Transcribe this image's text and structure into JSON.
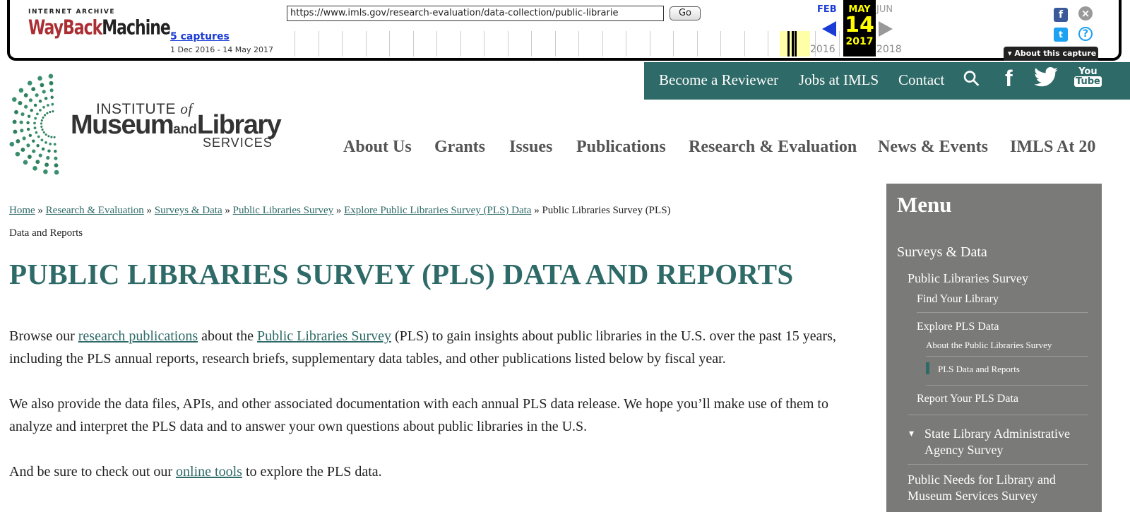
{
  "wayback": {
    "logo_top": "INTERNET ARCHIVE",
    "logo_main_1": "WayBack",
    "logo_main_2": "Machine",
    "url": "https://www.imls.gov/research-evaluation/data-collection/public-librarie",
    "go_label": "Go",
    "captures": "5 captures",
    "range": "1 Dec 2016 - 14 May 2017",
    "prev_month": "FEB",
    "cur_month": "MAY",
    "cur_day": "14",
    "cur_year": "2017",
    "next_month": "JUN",
    "prev_year": "2016",
    "next_year": "2018",
    "about": "About this capture",
    "facebook_glyph": "f",
    "twitter_glyph": "t",
    "close_glyph": "×",
    "help_glyph": "?"
  },
  "utility": {
    "reviewer": "Become a Reviewer",
    "jobs": "Jobs at IMLS",
    "contact": "Contact",
    "search_glyph": "⚲",
    "facebook_glyph": "f",
    "twitter_glyph": "🐦",
    "youtube_top": "You",
    "youtube_bottom": "Tube"
  },
  "logo": {
    "institute": "INSTITUTE",
    "of": "of",
    "museum": "Museum",
    "and": "and",
    "library": "Library",
    "services": "SERVICES"
  },
  "nav": [
    "About Us",
    "Grants",
    "Issues",
    "Publications",
    "Research & Evaluation",
    "News & Events",
    "IMLS At 20"
  ],
  "breadcrumb": {
    "home": "Home",
    "research": "Research & Evaluation",
    "surveys": "Surveys & Data",
    "pls": "Public Libraries Survey",
    "explore": "Explore Public Libraries Survey (PLS) Data",
    "sep": " » ",
    "current": "Public Libraries Survey (PLS) Data and Reports"
  },
  "title": "PUBLIC LIBRARIES SURVEY (PLS) DATA AND REPORTS",
  "p1": {
    "t1": "Browse our ",
    "link1": "research publications",
    "t2": " about the ",
    "link2": "Public Libraries Survey",
    "t3": " (PLS) to gain insights about public libraries in the U.S. over the past 15 years, including the PLS annual reports, research briefs, supplementary data tables, and other publications listed below by fiscal year."
  },
  "p2": "We also provide the data files, APIs, and other associated documentation with each annual PLS data release. We hope you’ll make use of them to analyze and interpret the PLS data and to answer your own questions about public libraries in the U.S.",
  "p3": {
    "t1": "And be sure to check out our ",
    "link": "online tools",
    "t2": " to explore the PLS data."
  },
  "sidebar": {
    "heading": "Menu",
    "surveys": "Surveys & Data",
    "pls": "Public Libraries Survey",
    "find": "Find Your Library",
    "explore": "Explore PLS Data",
    "about": "About the Public Libraries Survey",
    "reports": "PLS Data and Reports",
    "report_yours": "Report Your PLS Data",
    "state_arrow": "▾",
    "state": "State Library Administrative Agency Survey",
    "needs": "Public Needs for Library and Museum Services Survey"
  },
  "colors": {
    "accent": "#2e6a67",
    "sidebar": "#7a7a78",
    "wayback_blue": "#1a3bd6",
    "wayback_yellow": "#ffff00"
  }
}
